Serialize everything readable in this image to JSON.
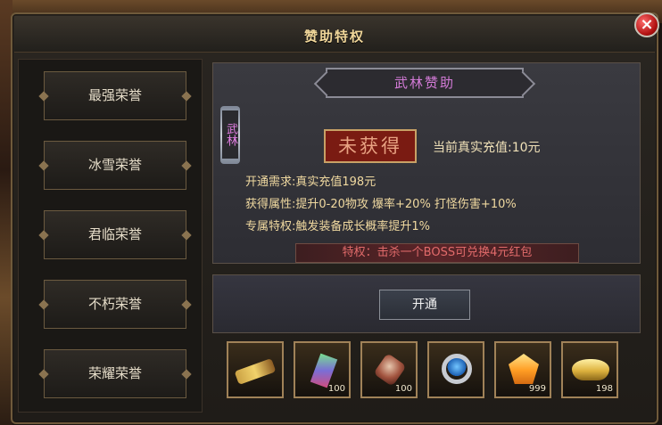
{
  "window": {
    "title": "赞助特权",
    "close_label": "×"
  },
  "sidebar": {
    "items": [
      {
        "label": "最强荣誉"
      },
      {
        "label": "冰雪荣誉"
      },
      {
        "label": "君临荣誉"
      },
      {
        "label": "不朽荣誉"
      },
      {
        "label": "荣耀荣誉"
      }
    ]
  },
  "info": {
    "header": "武林赞助",
    "badge": "武林",
    "status": "未获得",
    "current_recharge": "当前真实充值:10元",
    "line_requirement": "开通需求:真实充值198元",
    "line_attributes": "获得属性:提升0-20物攻 爆率+20% 打怪伤害+10%",
    "line_privilege": "专属特权:触发装备成长概率提升1%",
    "privilege_bar": "特权：击杀一个BOSS可兑换4元红包"
  },
  "action": {
    "open_label": "开通"
  },
  "rewards": [
    {
      "icon": "scroll-icon",
      "count": ""
    },
    {
      "icon": "crystal-icon",
      "count": "100"
    },
    {
      "icon": "rune-icon",
      "count": "100"
    },
    {
      "icon": "ring-icon",
      "count": ""
    },
    {
      "icon": "gem-icon",
      "count": "999"
    },
    {
      "icon": "ingot-icon",
      "count": "198"
    }
  ],
  "colors": {
    "title": "#f1d79a",
    "header": "#d47bd8",
    "status_bg": "#7a1b12",
    "privilege_text": "#e26b6b"
  }
}
